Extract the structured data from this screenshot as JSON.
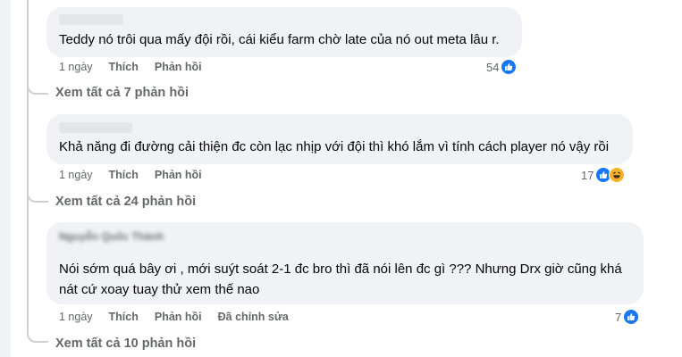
{
  "comments": [
    {
      "text": "Teddy nó trôi qua mấy đội rồi, cái kiểu farm chờ late của nó out meta lâu r.",
      "time": "1 ngày",
      "like_label": "Thích",
      "reply_label": "Phản hồi",
      "reaction_count": "54",
      "reactions": [
        "like-icon"
      ],
      "view_replies": "Xem tất cả 7 phản hồi"
    },
    {
      "text": "Khả năng đi đường cải thiện đc còn lạc nhịp với đội thì khó lắm vì tính cách player nó vậy rồi",
      "time": "1 ngày",
      "like_label": "Thích",
      "reply_label": "Phản hồi",
      "reaction_count": "17",
      "reactions": [
        "like-icon",
        "haha-icon"
      ],
      "view_replies": "Xem tất cả 24 phản hồi"
    },
    {
      "author": "Nguyễn Quốc Thành",
      "text_line1": "Nói sớm quá bây ơi , mới suýt soát 2-1 đc bro thì đã nói lên đc gì ??? Nhưng Drx giờ cũng khá",
      "text_line2": "nát cứ xoay tuay thử xem thế nao",
      "time": "1 ngày",
      "like_label": "Thích",
      "reply_label": "Phản hồi",
      "edited_label": "Đã chỉnh sửa",
      "reaction_count": "7",
      "reactions": [
        "like-icon"
      ],
      "view_replies": "Xem tất cả 10 phản hồi"
    }
  ],
  "colors": {
    "bubble": "#f0f2f5",
    "meta_text": "#65676b",
    "like_blue": "#1877f2",
    "haha_yellow": "#f7b125",
    "thread_line": "#ccd0d5"
  }
}
